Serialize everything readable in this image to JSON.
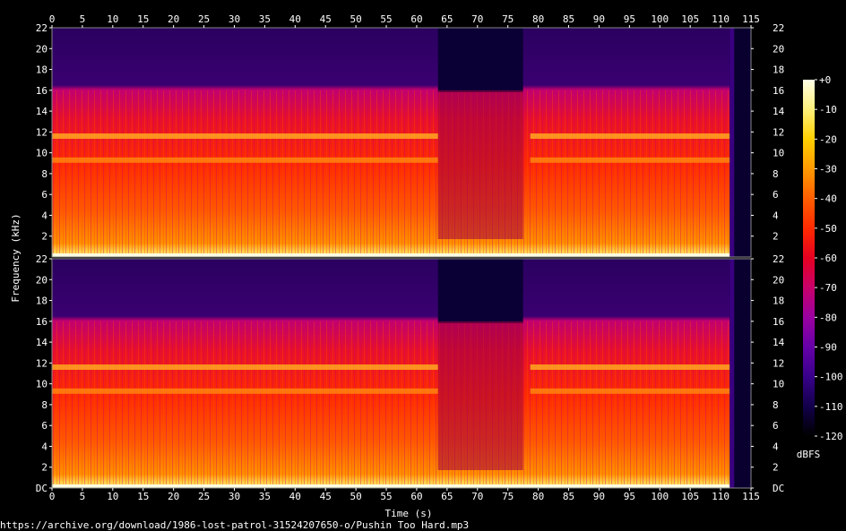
{
  "chart_data": {
    "type": "heatmap",
    "xlabel": "Time (s)",
    "ylabel": "Frequency (kHz)",
    "x_ticks": [
      "0",
      "5",
      "10",
      "15",
      "20",
      "25",
      "30",
      "35",
      "40",
      "45",
      "50",
      "55",
      "60",
      "65",
      "70",
      "75",
      "80",
      "85",
      "90",
      "95",
      "100",
      "105",
      "110",
      "115"
    ],
    "x_range": [
      0,
      115
    ],
    "channels": [
      {
        "y_ticks": [
          "2",
          "4",
          "6",
          "8",
          "10",
          "12",
          "14",
          "16",
          "18",
          "20",
          "22"
        ],
        "y_range": [
          0,
          22
        ]
      },
      {
        "y_ticks": [
          "DC",
          "2",
          "4",
          "6",
          "8",
          "10",
          "12",
          "14",
          "16",
          "18",
          "20",
          "22"
        ],
        "y_range": [
          0,
          22
        ]
      }
    ],
    "audio_end_s": 111.5,
    "quiet_section_s": [
      63.5,
      77.5
    ],
    "lowpass_khz": 16,
    "bright_bands_khz": [
      11.6,
      9.3
    ],
    "colorbar": {
      "ticks": [
        "+0",
        "-10",
        "-20",
        "-30",
        "-40",
        "-50",
        "-60",
        "-70",
        "-80",
        "-90",
        "-100",
        "-110",
        "-120"
      ],
      "range": [
        0,
        -120
      ],
      "label": "dBFS",
      "colors": [
        "#ffffe6",
        "#fff07a",
        "#ffd000",
        "#ff9a00",
        "#ff5e00",
        "#ff2a00",
        "#e60020",
        "#c8006a",
        "#9a00a0",
        "#6600a8",
        "#38008a",
        "#12004a",
        "#000000"
      ]
    }
  },
  "source_text": "https://archive.org/download/1986-lost-patrol-31524207650-o/Pushin Too Hard.mp3"
}
